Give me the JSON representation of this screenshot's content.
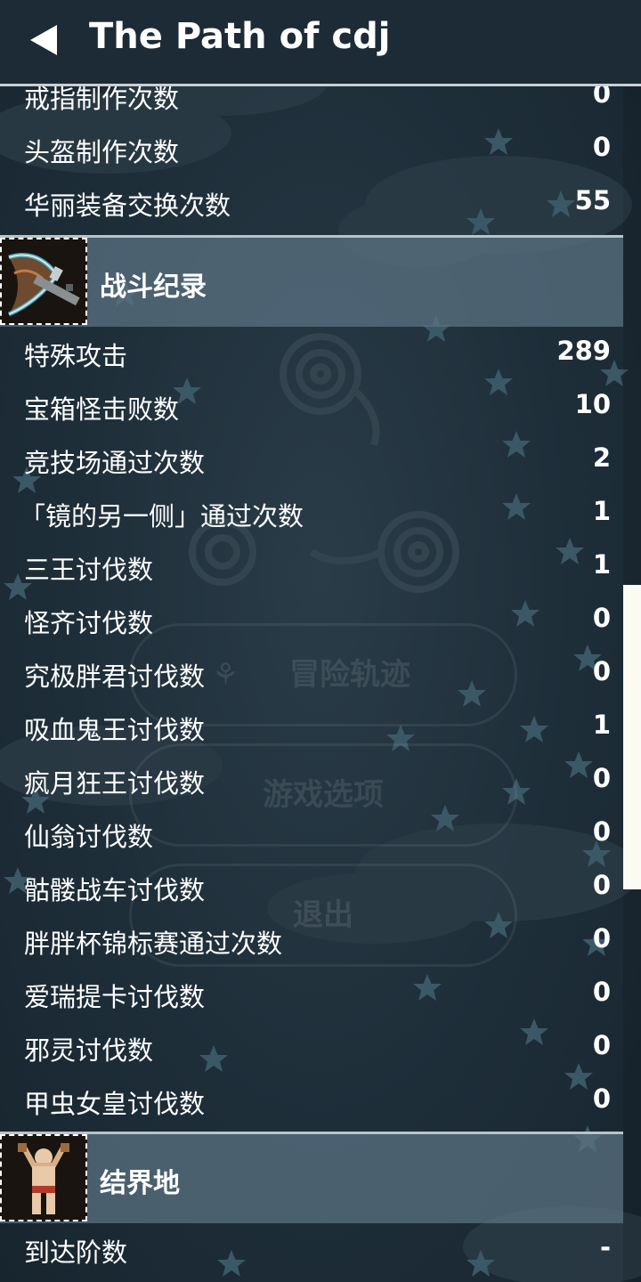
{
  "header": {
    "title": "The Path of cdj"
  },
  "background_menu": {
    "buttons": [
      "冒险轨迹",
      "游戏选项",
      "退出"
    ]
  },
  "sections": [
    {
      "title": "",
      "rows": [
        {
          "label": "戒指制作次数",
          "value": "0"
        },
        {
          "label": "头盔制作次数",
          "value": "0"
        },
        {
          "label": "华丽装备交换次数",
          "value": "55"
        }
      ]
    },
    {
      "title": "战斗纪录",
      "icon": "battle-axe-icon",
      "rows": [
        {
          "label": "特殊攻击",
          "value": "289"
        },
        {
          "label": "宝箱怪击败数",
          "value": "10"
        },
        {
          "label": "竞技场通过次数",
          "value": "2"
        },
        {
          "label": "「镜的另一侧」通过次数",
          "value": "1"
        },
        {
          "label": "三王讨伐数",
          "value": "1"
        },
        {
          "label": "怪齐讨伐数",
          "value": "0"
        },
        {
          "label": "究极胖君讨伐数",
          "value": "0"
        },
        {
          "label": "吸血鬼王讨伐数",
          "value": "1"
        },
        {
          "label": "疯月狂王讨伐数",
          "value": "0"
        },
        {
          "label": "仙翁讨伐数",
          "value": "0"
        },
        {
          "label": "骷髅战车讨伐数",
          "value": "0"
        },
        {
          "label": "胖胖杯锦标赛通过次数",
          "value": "0"
        },
        {
          "label": "爱瑞提卡讨伐数",
          "value": "0"
        },
        {
          "label": "邪灵讨伐数",
          "value": "0"
        },
        {
          "label": "甲虫女皇讨伐数",
          "value": "0"
        }
      ]
    },
    {
      "title": "结界地",
      "icon": "muscle-warrior-icon",
      "rows": [
        {
          "label": "到达阶数",
          "value": "-"
        }
      ]
    }
  ],
  "colors": {
    "background": "#1c2b36",
    "section_band": "#5d7585",
    "scroll_thumb": "#fbfbf3",
    "text": "#ffffff"
  }
}
